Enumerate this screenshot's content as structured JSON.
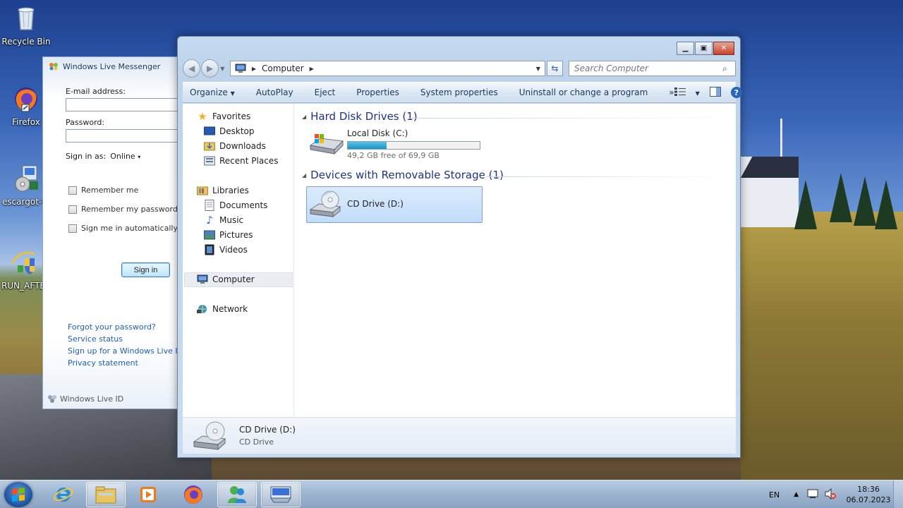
{
  "desktop": {
    "icons": [
      {
        "label": "Recycle Bin",
        "icon": "recycle-bin-icon"
      },
      {
        "label": "Firefox",
        "icon": "firefox-icon"
      },
      {
        "label": "escargot-w",
        "icon": "escargot-installer-icon"
      },
      {
        "label": "RUN_AFTE",
        "icon": "run-after-shield-icon"
      }
    ]
  },
  "messenger": {
    "title": "Windows Live Messenger",
    "email_label": "E-mail address:",
    "email_value": "",
    "password_label": "Password:",
    "password_value": "",
    "sign_in_as_label": "Sign in as:",
    "sign_in_as_value": "Online",
    "checkboxes": [
      {
        "label": "Remember me",
        "checked": false
      },
      {
        "label": "Remember my password",
        "checked": false
      },
      {
        "label": "Sign me in automatically",
        "checked": false
      }
    ],
    "sign_in_button": "Sign in",
    "links": [
      "Forgot your password?",
      "Service status",
      "Sign up for a Windows Live ID",
      "Privacy statement"
    ],
    "footer": "Windows Live ID"
  },
  "explorer": {
    "address": {
      "root_icon": "computer-icon",
      "crumbs": [
        "Computer"
      ]
    },
    "search_placeholder": "Search Computer",
    "toolbar": {
      "organize": "Organize",
      "items": [
        "AutoPlay",
        "Eject",
        "Properties",
        "System properties",
        "Uninstall or change a program"
      ],
      "more": "»"
    },
    "nav": {
      "favorites": "Favorites",
      "favorite_items": [
        "Desktop",
        "Downloads",
        "Recent Places"
      ],
      "libraries": "Libraries",
      "library_items": [
        "Documents",
        "Music",
        "Pictures",
        "Videos"
      ],
      "computer": "Computer",
      "network": "Network"
    },
    "groups": {
      "hard_disks": {
        "title": "Hard Disk Drives (1)",
        "drives": [
          {
            "name": "Local Disk (C:)",
            "free_text": "49,2 GB free of 69,9 GB",
            "used_fraction": 0.296
          }
        ]
      },
      "removable": {
        "title": "Devices with Removable Storage (1)",
        "drives": [
          {
            "name": "CD Drive (D:)"
          }
        ]
      }
    },
    "details": {
      "name": "CD Drive (D:)",
      "type": "CD Drive"
    }
  },
  "taskbar": {
    "apps": [
      "internet-explorer-icon",
      "windows-explorer-icon",
      "media-player-icon",
      "firefox-icon",
      "messenger-icon",
      "keyboard-icon"
    ],
    "language": "EN",
    "time": "18:36",
    "date": "06.07.2023"
  },
  "colors": {
    "link": "#1f5fb6",
    "group_header": "#1e3287",
    "selection": "#c1dcf9",
    "capacity_fill": "#1a95c9"
  }
}
